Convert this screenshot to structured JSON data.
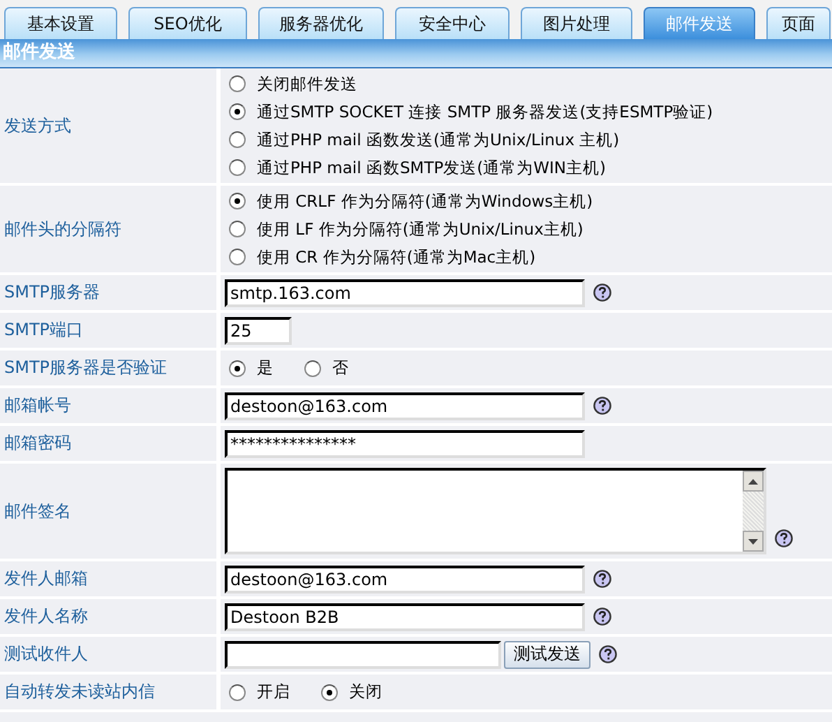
{
  "tabs": [
    {
      "label": "基本设置",
      "selected": false
    },
    {
      "label": "SEO优化",
      "selected": false
    },
    {
      "label": "服务器优化",
      "selected": false
    },
    {
      "label": "安全中心",
      "selected": false
    },
    {
      "label": "图片处理",
      "selected": false
    },
    {
      "label": "邮件发送",
      "selected": true
    },
    {
      "label": "页面",
      "selected": false
    }
  ],
  "section_title": "邮件发送",
  "rows": [
    {
      "label": "发送方式",
      "kind": "radio_list",
      "options": [
        {
          "label": "关闭邮件发送",
          "selected": false
        },
        {
          "label": "通过SMTP SOCKET 连接  SMTP 服务器发送(支持ESMTP验证)",
          "selected": true
        },
        {
          "label": "通过PHP mail 函数发送(通常为Unix/Linux 主机)",
          "selected": false
        },
        {
          "label": "通过PHP mail 函数SMTP发送(通常为WIN主机)",
          "selected": false
        }
      ]
    },
    {
      "label": "邮件头的分隔符",
      "kind": "radio_list",
      "options": [
        {
          "label": "使用  CRLF 作为分隔符(通常为Windows主机)",
          "selected": true
        },
        {
          "label": "使用  LF 作为分隔符(通常为Unix/Linux主机)",
          "selected": false
        },
        {
          "label": "使用  CR 作为分隔符(通常为Mac主机)",
          "selected": false
        }
      ]
    },
    {
      "label": "SMTP服务器",
      "kind": "text",
      "value": "smtp.163.com",
      "help": true
    },
    {
      "label": "SMTP端口",
      "kind": "short_text",
      "value": "25",
      "help": false
    },
    {
      "label": "SMTP服务器是否验证",
      "kind": "radio_inline",
      "options": [
        {
          "label": "是",
          "selected": true
        },
        {
          "label": "否",
          "selected": false
        }
      ]
    },
    {
      "label": "邮箱帐号",
      "kind": "text",
      "value": "destoon@163.com",
      "help": true
    },
    {
      "label": "邮箱密码",
      "kind": "text",
      "value": "***************",
      "help": false
    },
    {
      "label": "邮件签名",
      "kind": "textarea",
      "help": true
    },
    {
      "label": "发件人邮箱",
      "kind": "text",
      "value": "destoon@163.com",
      "help": true
    },
    {
      "label": "发件人名称",
      "kind": "text",
      "value": "Destoon B2B",
      "help": true
    },
    {
      "label": "测试收件人",
      "kind": "test",
      "button": "测试发送",
      "help": true
    },
    {
      "label": "自动转发未读站内信",
      "kind": "radio_inline",
      "options": [
        {
          "label": "开启",
          "selected": false
        },
        {
          "label": "关闭",
          "selected": true
        }
      ]
    }
  ]
}
